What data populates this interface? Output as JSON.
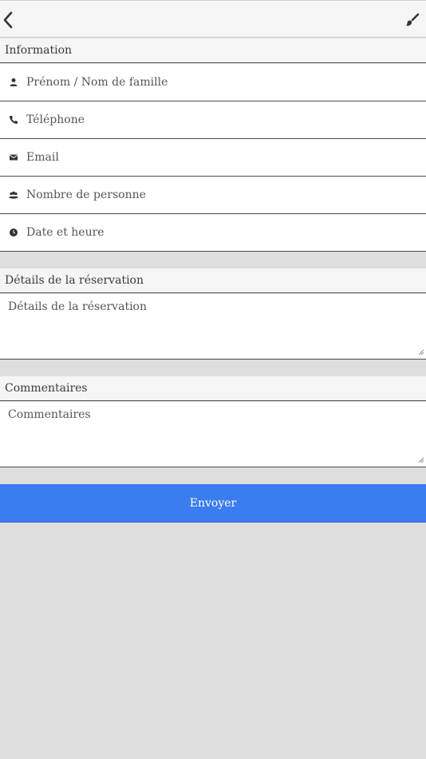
{
  "colors": {
    "background": "#dedede",
    "header_bg": "#f5f5f5",
    "field_bg": "#ffffff",
    "accent": "#3b7df0",
    "text": "#3a3a3a"
  },
  "toolbar": {
    "back_icon": "chevron-left-icon",
    "theme_icon": "paintbrush-icon"
  },
  "information": {
    "header": "Information",
    "fields": [
      {
        "icon": "user-icon",
        "placeholder": "Prénom / Nom de famille"
      },
      {
        "icon": "phone-icon",
        "placeholder": "Téléphone"
      },
      {
        "icon": "envelope-icon",
        "placeholder": "Email"
      },
      {
        "icon": "group-icon",
        "placeholder": "Nombre de personne"
      },
      {
        "icon": "clock-icon",
        "placeholder": "Date et heure"
      }
    ]
  },
  "details": {
    "header": "Détails de la réservation",
    "placeholder": "Détails de la réservation"
  },
  "comments": {
    "header": "Commentaires",
    "placeholder": "Commentaires"
  },
  "submit": {
    "label": "Envoyer"
  }
}
